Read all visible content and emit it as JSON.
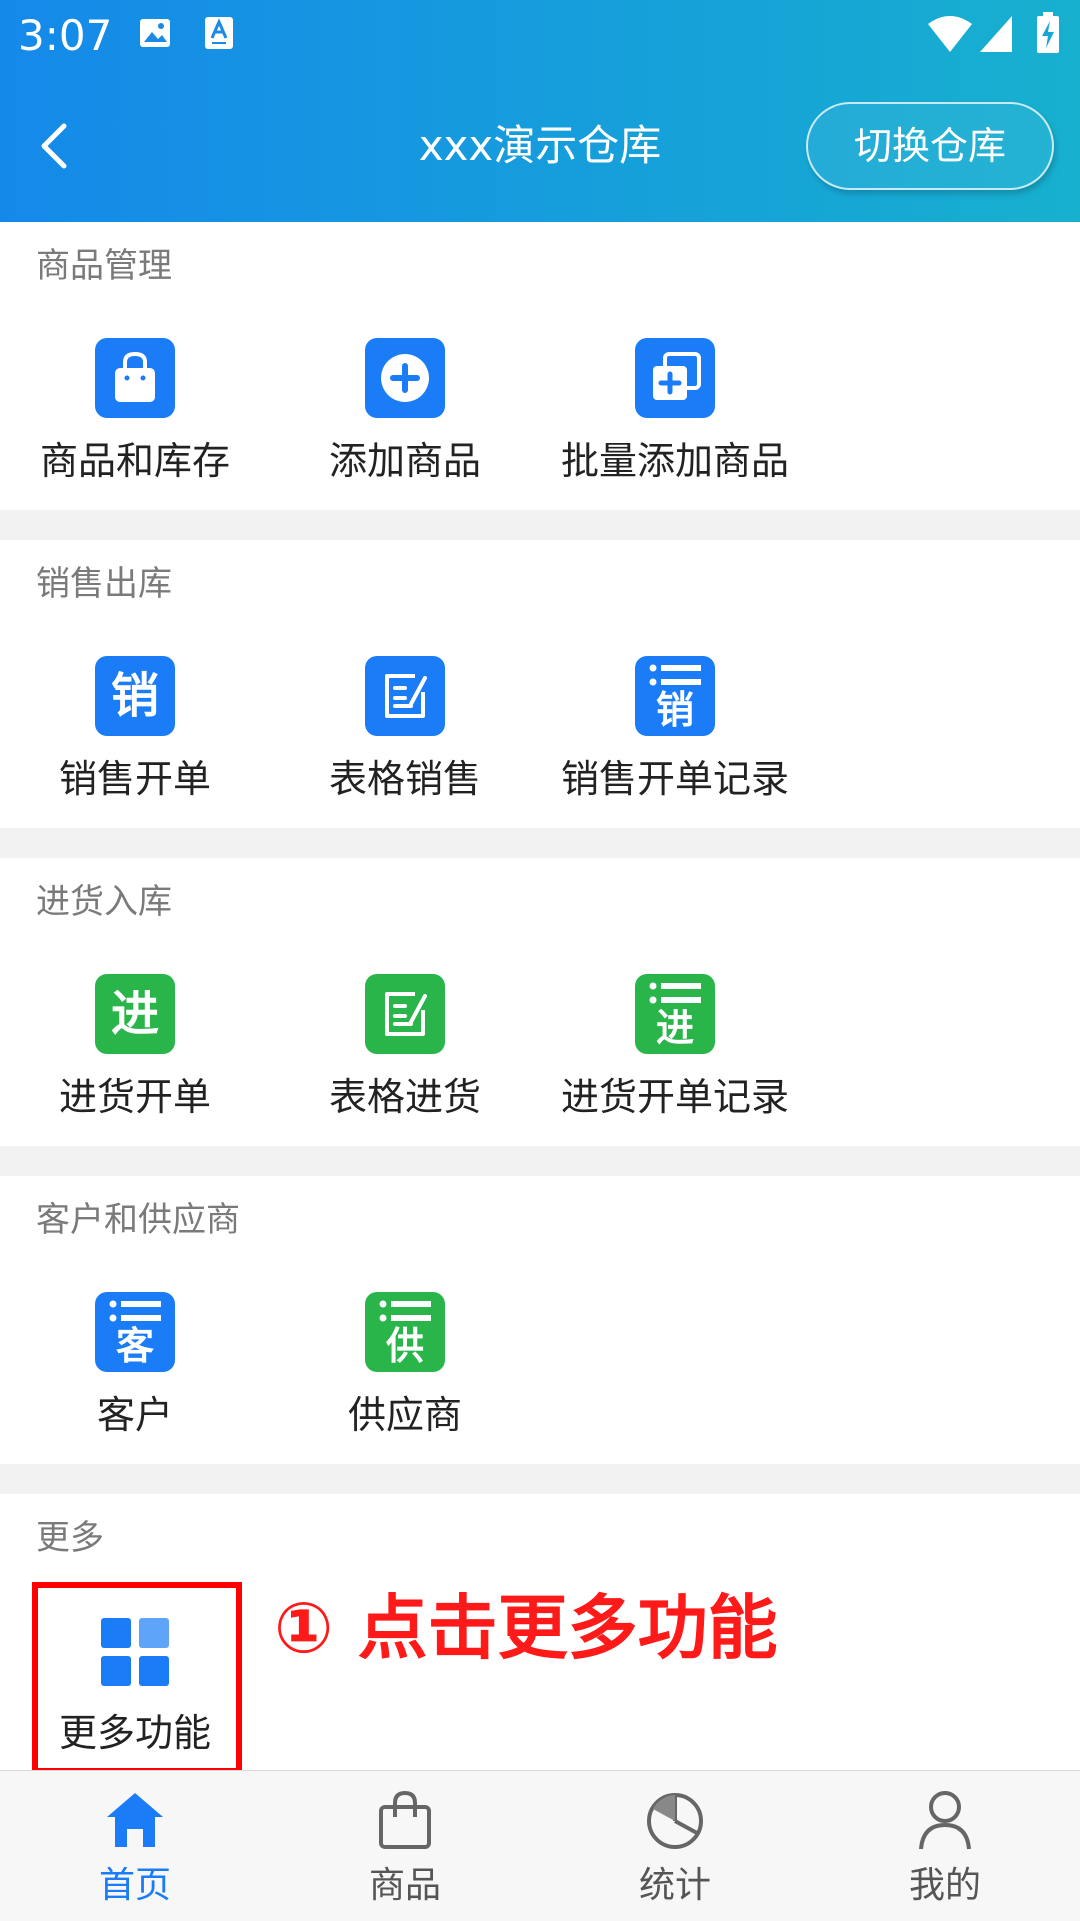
{
  "statusbar": {
    "time": "3:07"
  },
  "header": {
    "title": "xxx演示仓库",
    "switch_label": "切换仓库"
  },
  "sections": {
    "goods": {
      "title": "商品管理",
      "items": [
        {
          "label": "商品和库存",
          "icon": "shopping-bag-icon"
        },
        {
          "label": "添加商品",
          "icon": "plus-circle-icon"
        },
        {
          "label": "批量添加商品",
          "icon": "batch-add-icon"
        }
      ]
    },
    "sales": {
      "title": "销售出库",
      "items": [
        {
          "label": "销售开单",
          "icon": "sales-order-icon",
          "glyph": "销"
        },
        {
          "label": "表格销售",
          "icon": "form-edit-icon"
        },
        {
          "label": "销售开单记录",
          "icon": "sales-record-icon",
          "glyph": "销"
        }
      ]
    },
    "purchase": {
      "title": "进货入库",
      "items": [
        {
          "label": "进货开单",
          "icon": "purchase-order-icon",
          "glyph": "进"
        },
        {
          "label": "表格进货",
          "icon": "form-edit-icon"
        },
        {
          "label": "进货开单记录",
          "icon": "purchase-record-icon",
          "glyph": "进"
        }
      ]
    },
    "partners": {
      "title": "客户和供应商",
      "items": [
        {
          "label": "客户",
          "icon": "customer-list-icon",
          "glyph": "客"
        },
        {
          "label": "供应商",
          "icon": "supplier-list-icon",
          "glyph": "供"
        }
      ]
    },
    "more": {
      "title": "更多",
      "items": [
        {
          "label": "更多功能",
          "icon": "grid-icon"
        }
      ]
    }
  },
  "annotation": "① 点击更多功能",
  "tabs": [
    {
      "label": "首页",
      "icon": "home-icon",
      "active": true
    },
    {
      "label": "商品",
      "icon": "bag-icon",
      "active": false
    },
    {
      "label": "统计",
      "icon": "pie-chart-icon",
      "active": false
    },
    {
      "label": "我的",
      "icon": "user-icon",
      "active": false
    }
  ],
  "colors": {
    "primary_blue": "#1a7cf6",
    "green": "#29b549",
    "highlight_red": "#ff0000",
    "header_gradient_start": "#1589ea",
    "header_gradient_end": "#17b0cf"
  }
}
